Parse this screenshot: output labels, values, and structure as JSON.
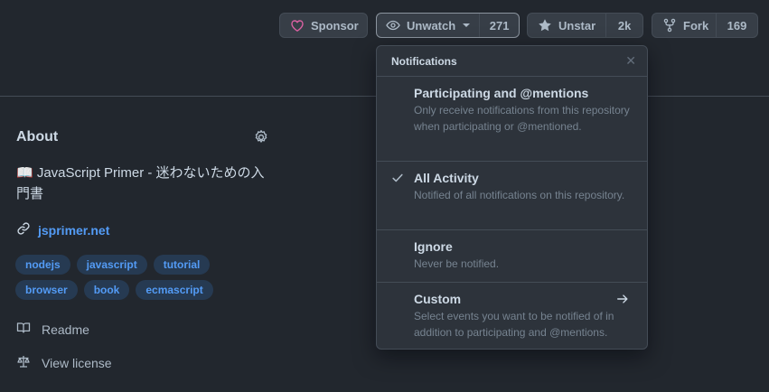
{
  "actions": {
    "sponsor": {
      "label": "Sponsor"
    },
    "watch": {
      "label": "Unwatch",
      "count": "271"
    },
    "star": {
      "label": "Unstar",
      "count": "2k"
    },
    "fork": {
      "label": "Fork",
      "count": "169"
    }
  },
  "about": {
    "title": "About",
    "description": "📖 JavaScript Primer - 迷わないための入門書",
    "website": "jsprimer.net",
    "topics": [
      "nodejs",
      "javascript",
      "tutorial",
      "browser",
      "book",
      "ecmascript"
    ],
    "readme": "Readme",
    "license": "View license"
  },
  "notifications": {
    "header": "Notifications",
    "options": [
      {
        "title": "Participating and @mentions",
        "desc": "Only receive notifications from this repository when participating or @mentioned.",
        "selected": false
      },
      {
        "title": "All Activity",
        "desc": "Notified of all notifications on this repository.",
        "selected": true
      },
      {
        "title": "Ignore",
        "desc": "Never be notified.",
        "selected": false
      },
      {
        "title": "Custom",
        "desc": "Select events you want to be notified of in addition to participating and @mentions.",
        "selected": false
      }
    ]
  },
  "colors": {
    "background": "#22272e",
    "link": "#539bf5",
    "topic_bg": "#263a52",
    "heart": "#db61a2"
  }
}
